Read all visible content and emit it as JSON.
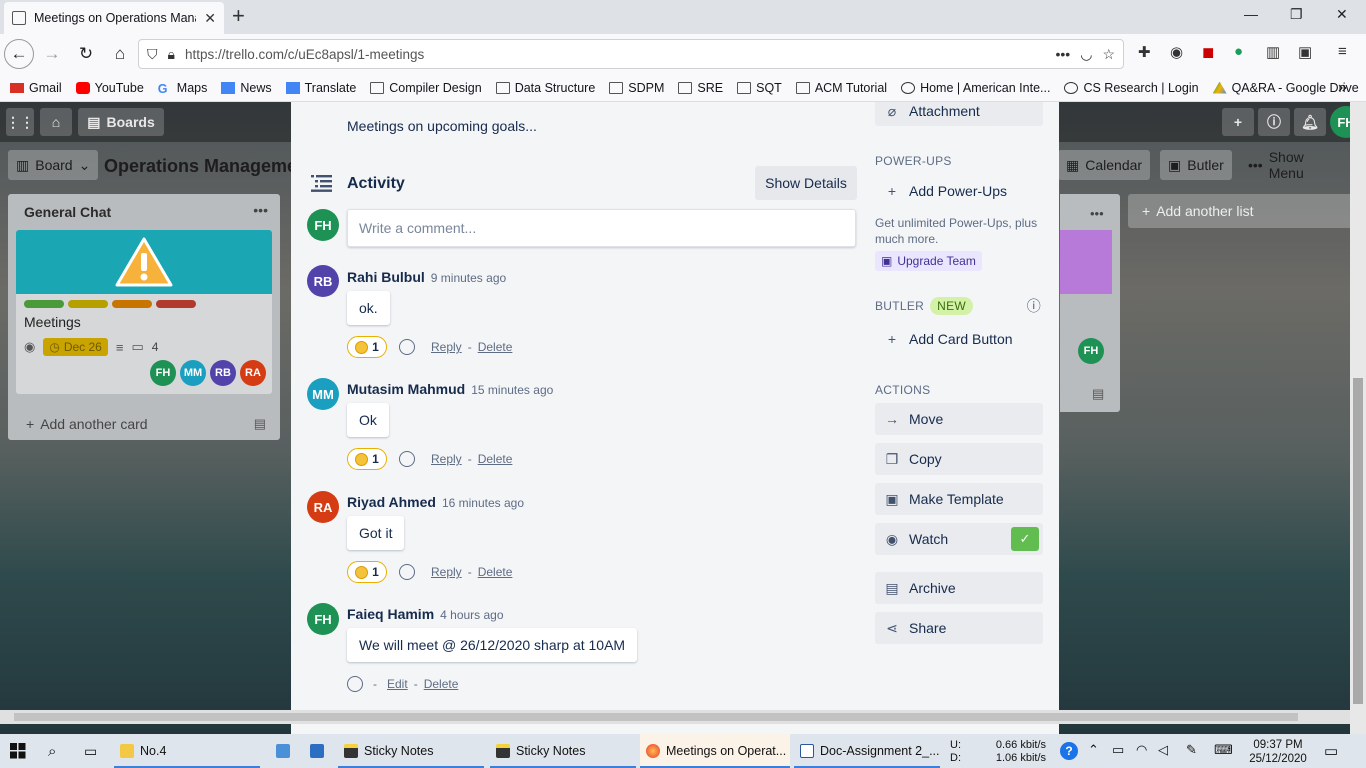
{
  "browser": {
    "tab_title": "Meetings on Operations Mana",
    "url": "https://trello.com/c/uEc8apsl/1-meetings",
    "bookmarks": [
      "Gmail",
      "YouTube",
      "Maps",
      "News",
      "Translate",
      "Compiler Design",
      "Data Structure",
      "SDPM",
      "SRE",
      "SQT",
      "ACM Tutorial",
      "Home | American Inte...",
      "CS Research | Login",
      "QA&RA - Google Drive"
    ]
  },
  "trello": {
    "boards_label": "Boards",
    "board_view": "Board",
    "board_name": "Operations Manageme",
    "calendar_label": "Calendar",
    "butler_label": "Butler",
    "show_menu_label": "Show Menu",
    "user_initials": "FH",
    "list": {
      "title": "General Chat",
      "card_title": "Meetings",
      "due": "Dec 26",
      "comment_count": "4",
      "members": [
        "FH",
        "MM",
        "RB",
        "RA"
      ],
      "add_card": "Add another card"
    },
    "add_list": "Add another list",
    "list2_member": "FH"
  },
  "modal": {
    "description": "Meetings on upcoming goals...",
    "activity_title": "Activity",
    "show_details": "Show Details",
    "current_user": "FH",
    "comment_placeholder": "Write a comment...",
    "comments": [
      {
        "initials": "RB",
        "author": "Rahi Bulbul",
        "time": "9 minutes ago",
        "text": "ok.",
        "reactions": "1",
        "reply": "Reply",
        "delete": "Delete"
      },
      {
        "initials": "MM",
        "author": "Mutasim Mahmud",
        "time": "15 minutes ago",
        "text": "Ok",
        "reactions": "1",
        "reply": "Reply",
        "delete": "Delete"
      },
      {
        "initials": "RA",
        "author": "Riyad Ahmed",
        "time": "16 minutes ago",
        "text": "Got it",
        "reactions": "1",
        "reply": "Reply",
        "delete": "Delete"
      },
      {
        "initials": "FH",
        "author": "Faieq Hamim",
        "time": "4 hours ago",
        "text": "We will meet @ 26/12/2020 sharp at 10AM",
        "edit": "Edit",
        "delete": "Delete"
      }
    ],
    "sidebar": {
      "attachment": "Attachment",
      "powerups_head": "POWER-UPS",
      "add_powerups": "Add Power-Ups",
      "powerups_note": "Get unlimited Power-Ups, plus much more.",
      "upgrade": "Upgrade Team",
      "butler_head": "BUTLER",
      "new_badge": "NEW",
      "add_card_button": "Add Card Button",
      "actions_head": "ACTIONS",
      "move": "Move",
      "copy": "Copy",
      "make_template": "Make Template",
      "watch": "Watch",
      "archive": "Archive",
      "share": "Share"
    }
  },
  "taskbar": {
    "items": [
      "No.4",
      "Sticky Notes",
      "Sticky Notes",
      "Meetings on Operat...",
      "Doc-Assignment 2_..."
    ],
    "net_up_label": "U:",
    "net_down_label": "D:",
    "net_up": "0.66 kbit/s",
    "net_down": "1.06 kbit/s",
    "time": "09:37 PM",
    "date": "25/12/2020"
  },
  "colors": {
    "fh": "#1e9154",
    "mm": "#1b9fc0",
    "rb": "#5243aa",
    "ra": "#d63c13",
    "cover": "#1aa6b3"
  }
}
